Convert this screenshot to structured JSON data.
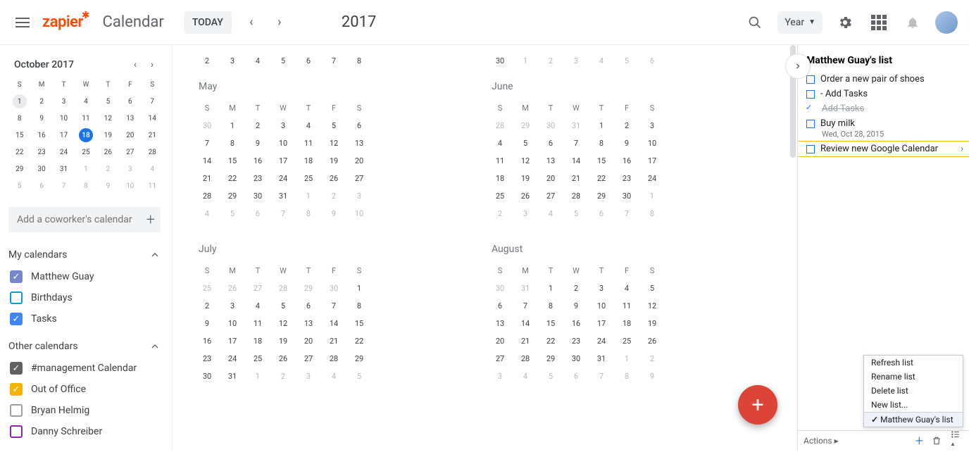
{
  "header": {
    "logo": "zapier",
    "product": "Calendar",
    "today_label": "TODAY",
    "year_title": "2017",
    "view_label": "Year"
  },
  "mini_calendar": {
    "title": "October 2017",
    "dow": [
      "S",
      "M",
      "T",
      "W",
      "T",
      "F",
      "S"
    ],
    "rows": [
      [
        {
          "d": "1",
          "cls": "first"
        },
        {
          "d": "2",
          "cls": "in"
        },
        {
          "d": "3",
          "cls": "in"
        },
        {
          "d": "4",
          "cls": "in"
        },
        {
          "d": "5",
          "cls": "in"
        },
        {
          "d": "6",
          "cls": "in"
        },
        {
          "d": "7",
          "cls": "in"
        }
      ],
      [
        {
          "d": "8",
          "cls": "in"
        },
        {
          "d": "9",
          "cls": "in"
        },
        {
          "d": "10",
          "cls": "in"
        },
        {
          "d": "11",
          "cls": "in"
        },
        {
          "d": "12",
          "cls": "in"
        },
        {
          "d": "13",
          "cls": "in"
        },
        {
          "d": "14",
          "cls": "in"
        }
      ],
      [
        {
          "d": "15",
          "cls": "in"
        },
        {
          "d": "16",
          "cls": "in"
        },
        {
          "d": "17",
          "cls": "in"
        },
        {
          "d": "18",
          "cls": "today"
        },
        {
          "d": "19",
          "cls": "in"
        },
        {
          "d": "20",
          "cls": "in"
        },
        {
          "d": "21",
          "cls": "in"
        }
      ],
      [
        {
          "d": "22",
          "cls": "in"
        },
        {
          "d": "23",
          "cls": "in"
        },
        {
          "d": "24",
          "cls": "in"
        },
        {
          "d": "25",
          "cls": "in"
        },
        {
          "d": "26",
          "cls": "in"
        },
        {
          "d": "27",
          "cls": "in"
        },
        {
          "d": "28",
          "cls": "in"
        }
      ],
      [
        {
          "d": "29",
          "cls": "in"
        },
        {
          "d": "30",
          "cls": "in"
        },
        {
          "d": "31",
          "cls": "in"
        },
        {
          "d": "1",
          "cls": "out"
        },
        {
          "d": "2",
          "cls": "out"
        },
        {
          "d": "3",
          "cls": "out"
        },
        {
          "d": "4",
          "cls": "out"
        }
      ],
      [
        {
          "d": "5",
          "cls": "out"
        },
        {
          "d": "6",
          "cls": "out"
        },
        {
          "d": "7",
          "cls": "out"
        },
        {
          "d": "8",
          "cls": "out"
        },
        {
          "d": "9",
          "cls": "out"
        },
        {
          "d": "10",
          "cls": "out"
        },
        {
          "d": "11",
          "cls": "out"
        }
      ]
    ]
  },
  "add_coworker_placeholder": "Add a coworker's calendar",
  "my_calendars": {
    "title": "My calendars",
    "items": [
      {
        "label": "Matthew Guay",
        "color": "#7986cb",
        "checked": true
      },
      {
        "label": "Birthdays",
        "color": "#039be5",
        "checked": false
      },
      {
        "label": "Tasks",
        "color": "#4285f4",
        "checked": true
      }
    ]
  },
  "other_calendars": {
    "title": "Other calendars",
    "items": [
      {
        "label": "#management Calendar",
        "color": "#616161",
        "checked": true
      },
      {
        "label": "Out of Office",
        "color": "#f4b400",
        "checked": true
      },
      {
        "label": "Bryan Helmig",
        "color": "#9e9e9e",
        "checked": false
      },
      {
        "label": "Danny Schreiber",
        "color": "#8e24aa",
        "checked": false
      }
    ]
  },
  "frag_left": [
    "2",
    "3",
    "4",
    "5",
    "6",
    "7",
    "8"
  ],
  "frag_right": [
    "30",
    "1",
    "2",
    "3",
    "4",
    "5",
    "6"
  ],
  "frag_right_out_first": true,
  "months": [
    {
      "name": "May",
      "rows": [
        [
          {
            "d": "30",
            "o": 1
          },
          {
            "d": "1"
          },
          {
            "d": "2"
          },
          {
            "d": "3"
          },
          {
            "d": "4"
          },
          {
            "d": "5"
          },
          {
            "d": "6"
          }
        ],
        [
          {
            "d": "7"
          },
          {
            "d": "8"
          },
          {
            "d": "9"
          },
          {
            "d": "10"
          },
          {
            "d": "11"
          },
          {
            "d": "12"
          },
          {
            "d": "13"
          }
        ],
        [
          {
            "d": "14"
          },
          {
            "d": "15"
          },
          {
            "d": "16"
          },
          {
            "d": "17"
          },
          {
            "d": "18"
          },
          {
            "d": "19"
          },
          {
            "d": "20"
          }
        ],
        [
          {
            "d": "21"
          },
          {
            "d": "22"
          },
          {
            "d": "23"
          },
          {
            "d": "24"
          },
          {
            "d": "25"
          },
          {
            "d": "26"
          },
          {
            "d": "27"
          }
        ],
        [
          {
            "d": "28"
          },
          {
            "d": "29"
          },
          {
            "d": "30"
          },
          {
            "d": "31"
          },
          {
            "d": "1",
            "o": 1
          },
          {
            "d": "2",
            "o": 1
          },
          {
            "d": "3",
            "o": 1
          }
        ],
        [
          {
            "d": "4",
            "o": 1
          },
          {
            "d": "5",
            "o": 1
          },
          {
            "d": "6",
            "o": 1
          },
          {
            "d": "7",
            "o": 1
          },
          {
            "d": "8",
            "o": 1
          },
          {
            "d": "9",
            "o": 1
          },
          {
            "d": "10",
            "o": 1
          }
        ]
      ]
    },
    {
      "name": "June",
      "rows": [
        [
          {
            "d": "28",
            "o": 1
          },
          {
            "d": "29",
            "o": 1
          },
          {
            "d": "30",
            "o": 1
          },
          {
            "d": "31",
            "o": 1
          },
          {
            "d": "1"
          },
          {
            "d": "2"
          },
          {
            "d": "3"
          }
        ],
        [
          {
            "d": "4"
          },
          {
            "d": "5"
          },
          {
            "d": "6"
          },
          {
            "d": "7"
          },
          {
            "d": "8"
          },
          {
            "d": "9"
          },
          {
            "d": "10"
          }
        ],
        [
          {
            "d": "11"
          },
          {
            "d": "12"
          },
          {
            "d": "13"
          },
          {
            "d": "14"
          },
          {
            "d": "15"
          },
          {
            "d": "16"
          },
          {
            "d": "17"
          }
        ],
        [
          {
            "d": "18"
          },
          {
            "d": "19"
          },
          {
            "d": "20"
          },
          {
            "d": "21"
          },
          {
            "d": "22"
          },
          {
            "d": "23"
          },
          {
            "d": "24"
          }
        ],
        [
          {
            "d": "25"
          },
          {
            "d": "26"
          },
          {
            "d": "27"
          },
          {
            "d": "28"
          },
          {
            "d": "29"
          },
          {
            "d": "30"
          },
          {
            "d": "1",
            "o": 1
          }
        ],
        [
          {
            "d": "2",
            "o": 1
          },
          {
            "d": "3",
            "o": 1
          },
          {
            "d": "4",
            "o": 1
          },
          {
            "d": "5",
            "o": 1
          },
          {
            "d": "6",
            "o": 1
          },
          {
            "d": "7",
            "o": 1
          },
          {
            "d": "8",
            "o": 1
          }
        ]
      ]
    },
    {
      "name": "July",
      "rows": [
        [
          {
            "d": "25",
            "o": 1
          },
          {
            "d": "26",
            "o": 1
          },
          {
            "d": "27",
            "o": 1
          },
          {
            "d": "28",
            "o": 1
          },
          {
            "d": "29",
            "o": 1
          },
          {
            "d": "30",
            "o": 1
          },
          {
            "d": "1"
          }
        ],
        [
          {
            "d": "2"
          },
          {
            "d": "3"
          },
          {
            "d": "4"
          },
          {
            "d": "5"
          },
          {
            "d": "6"
          },
          {
            "d": "7"
          },
          {
            "d": "8"
          }
        ],
        [
          {
            "d": "9"
          },
          {
            "d": "10"
          },
          {
            "d": "11"
          },
          {
            "d": "12"
          },
          {
            "d": "13"
          },
          {
            "d": "14"
          },
          {
            "d": "15"
          }
        ],
        [
          {
            "d": "16"
          },
          {
            "d": "17"
          },
          {
            "d": "18"
          },
          {
            "d": "19"
          },
          {
            "d": "20"
          },
          {
            "d": "21"
          },
          {
            "d": "22"
          }
        ],
        [
          {
            "d": "23"
          },
          {
            "d": "24"
          },
          {
            "d": "25"
          },
          {
            "d": "26"
          },
          {
            "d": "27"
          },
          {
            "d": "28"
          },
          {
            "d": "29"
          }
        ],
        [
          {
            "d": "30"
          },
          {
            "d": "31"
          },
          {
            "d": "1",
            "o": 1
          },
          {
            "d": "2",
            "o": 1
          },
          {
            "d": "3",
            "o": 1
          },
          {
            "d": "4",
            "o": 1
          },
          {
            "d": "5",
            "o": 1
          }
        ]
      ]
    },
    {
      "name": "August",
      "rows": [
        [
          {
            "d": "30",
            "o": 1
          },
          {
            "d": "31",
            "o": 1
          },
          {
            "d": "1"
          },
          {
            "d": "2"
          },
          {
            "d": "3"
          },
          {
            "d": "4"
          },
          {
            "d": "5"
          }
        ],
        [
          {
            "d": "6"
          },
          {
            "d": "7"
          },
          {
            "d": "8"
          },
          {
            "d": "9"
          },
          {
            "d": "10"
          },
          {
            "d": "11"
          },
          {
            "d": "12"
          }
        ],
        [
          {
            "d": "13"
          },
          {
            "d": "14"
          },
          {
            "d": "15"
          },
          {
            "d": "16"
          },
          {
            "d": "17"
          },
          {
            "d": "18"
          },
          {
            "d": "19"
          }
        ],
        [
          {
            "d": "20"
          },
          {
            "d": "21"
          },
          {
            "d": "22"
          },
          {
            "d": "23"
          },
          {
            "d": "24"
          },
          {
            "d": "25"
          },
          {
            "d": "26"
          }
        ],
        [
          {
            "d": "27"
          },
          {
            "d": "28"
          },
          {
            "d": "29"
          },
          {
            "d": "30"
          },
          {
            "d": "31"
          },
          {
            "d": "1",
            "o": 1
          },
          {
            "d": "2",
            "o": 1
          }
        ],
        [
          {
            "d": "3",
            "o": 1
          },
          {
            "d": "4",
            "o": 1
          },
          {
            "d": "5",
            "o": 1
          },
          {
            "d": "6",
            "o": 1
          },
          {
            "d": "7",
            "o": 1
          },
          {
            "d": "8",
            "o": 1
          },
          {
            "d": "9",
            "o": 1
          }
        ]
      ]
    }
  ],
  "dow_full": [
    "S",
    "M",
    "T",
    "W",
    "T",
    "F",
    "S"
  ],
  "tasks": {
    "title": "Matthew Guay's list",
    "items": [
      {
        "text": "Order a new pair of shoes",
        "done": false
      },
      {
        "text": "- Add Tasks",
        "done": false
      },
      {
        "text": "Add Tasks",
        "done": true,
        "struck": true
      },
      {
        "text": "Buy milk",
        "done": false,
        "sub": "Wed, Oct 28, 2015"
      },
      {
        "text": "Review new Google Calendar",
        "done": false,
        "highlight": true,
        "arrow": true
      }
    ],
    "footer_actions": "Actions"
  },
  "context_menu": [
    "Refresh list",
    "Rename list",
    "Delete list",
    "New list..."
  ],
  "context_menu_checked": "Matthew Guay's list"
}
